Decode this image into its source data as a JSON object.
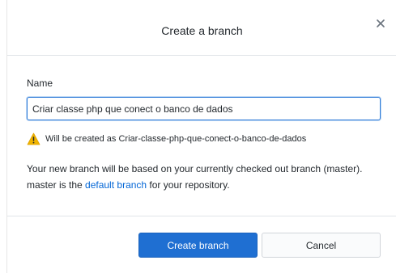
{
  "dialog": {
    "title": "Create a branch",
    "close_icon": "close-icon"
  },
  "form": {
    "name_label": "Name",
    "name_value": "Criar classe php que conect o banco de dados",
    "warning_icon": "warning-icon",
    "warning_text": "Will be created as Criar-classe-php-que-conect-o-banco-de-dados",
    "description_before": "Your new branch will be based on your currently checked out branch (master). master is the ",
    "description_link": "default branch",
    "description_after": " for your repository."
  },
  "footer": {
    "create_label": "Create branch",
    "cancel_label": "Cancel"
  },
  "colors": {
    "accent": "#1f6fd2",
    "link": "#0366d6",
    "warning": "#f0b400"
  }
}
